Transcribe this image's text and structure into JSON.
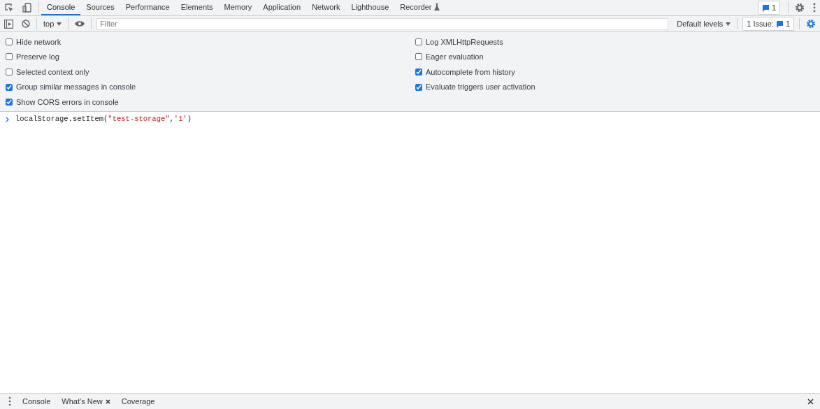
{
  "main_tabs": [
    {
      "label": "Console",
      "selected": true
    },
    {
      "label": "Sources",
      "selected": false
    },
    {
      "label": "Performance",
      "selected": false
    },
    {
      "label": "Elements",
      "selected": false
    },
    {
      "label": "Memory",
      "selected": false
    },
    {
      "label": "Application",
      "selected": false
    },
    {
      "label": "Network",
      "selected": false
    },
    {
      "label": "Lighthouse",
      "selected": false
    },
    {
      "label": "Recorder",
      "selected": false,
      "experimental": true
    }
  ],
  "messages_badge": "1",
  "toolbar": {
    "context": "top",
    "filter": {
      "placeholder": "Filter"
    },
    "levels": "Default levels",
    "issues_label": "1 Issue:",
    "issues_count": "1"
  },
  "settings": {
    "left": [
      {
        "label": "Hide network",
        "checked": false
      },
      {
        "label": "Preserve log",
        "checked": false
      },
      {
        "label": "Selected context only",
        "checked": false
      },
      {
        "label": "Group similar messages in console",
        "checked": true
      },
      {
        "label": "Show CORS errors in console",
        "checked": true
      }
    ],
    "right": [
      {
        "label": "Log XMLHttpRequests",
        "checked": false
      },
      {
        "label": "Eager evaluation",
        "checked": false
      },
      {
        "label": "Autocomplete from history",
        "checked": true
      },
      {
        "label": "Evaluate triggers user activation",
        "checked": true
      }
    ]
  },
  "console_input": [
    {
      "text": "localStorage.setItem(",
      "kind": "code"
    },
    {
      "text": "\"test-storage\"",
      "kind": "string"
    },
    {
      "text": ",",
      "kind": "code"
    },
    {
      "text": "'1'",
      "kind": "string"
    },
    {
      "text": ")",
      "kind": "code"
    }
  ],
  "drawer_tabs": [
    {
      "label": "Console",
      "closable": false
    },
    {
      "label": "What's New",
      "closable": true
    },
    {
      "label": "Coverage",
      "closable": false
    }
  ]
}
